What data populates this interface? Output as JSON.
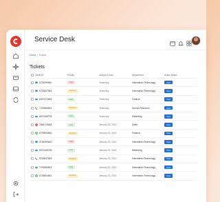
{
  "app": {
    "title": "Service Desk"
  },
  "breadcrumb": {
    "home": "Home",
    "current": "Tickets"
  },
  "page": {
    "title": "Tickets"
  },
  "table": {
    "headers": [
      "Ticket ID",
      "Priority",
      "Assigned Date",
      "Department",
      "Action Button"
    ],
    "action_label": "View",
    "rows": [
      {
        "id": "3728299640",
        "channel": "chat-icon",
        "priority": "High",
        "date": "Yesterday",
        "dept": "Information Technology"
      },
      {
        "id": "9728647563",
        "channel": "chat-icon",
        "priority": "Medium",
        "date": "Yesterday",
        "dept": "Information Technology"
      },
      {
        "id": "6397472649",
        "channel": "email-icon",
        "priority": "Low",
        "date": "Yesterday",
        "dept": "Finance"
      },
      {
        "id": "7476665813",
        "channel": "phone-icon",
        "priority": "Medium",
        "date": "Yesterday",
        "dept": "Human Resource"
      },
      {
        "id": "6572445793",
        "channel": "email-icon",
        "priority": "Low",
        "date": "Yesterday",
        "dept": "Marketing"
      },
      {
        "id": "7656719648",
        "channel": "alert-icon",
        "priority": "Low",
        "date": "January 23, 2024",
        "dept": "Sales"
      },
      {
        "id": "6739834651",
        "channel": "whatsapp-icon",
        "priority": "Medium",
        "date": "January 23, 2024",
        "dept": "Finance"
      },
      {
        "id": "3728299640",
        "channel": "chat-icon",
        "priority": "High",
        "date": "January 23, 2024",
        "dept": "Information Technology"
      },
      {
        "id": "6572445793",
        "channel": "email-icon",
        "priority": "Low",
        "date": "January 23, 2024",
        "dept": "Marketing"
      },
      {
        "id": "9728647563",
        "channel": "phone-icon",
        "priority": "Medium",
        "date": "January 23, 2024",
        "dept": "Information Technology"
      },
      {
        "id": "7476665813",
        "channel": "email-icon",
        "priority": "Low",
        "date": "January 23, 2024",
        "dept": "Information Technology"
      },
      {
        "id": "6739834651",
        "channel": "whatsapp-icon",
        "priority": "Medium",
        "date": "January 23, 2024",
        "dept": "Information Technology"
      }
    ]
  },
  "icons": {
    "sidebar": [
      "home-icon",
      "compass-icon",
      "ticket-icon",
      "inbox-icon",
      "sync-icon",
      "settings-icon",
      "logout-icon"
    ],
    "header": [
      "calendar-icon",
      "bell-icon",
      "grid-icon"
    ]
  },
  "colors": {
    "brand": "#e8352b",
    "accent": "#1f6fe0",
    "high": "#d73a3a",
    "medium": "#c08a00",
    "low": "#2f8a3e"
  }
}
